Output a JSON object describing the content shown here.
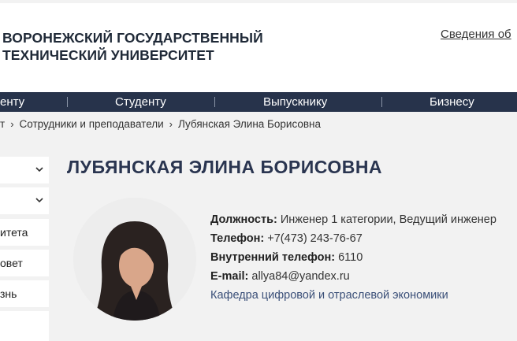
{
  "header": {
    "title_line1": "ВОРОНЕЖСКИЙ ГОСУДАРСТВЕННЫЙ",
    "title_line2": "ТЕХНИЧЕСКИЙ УНИВЕРСИТЕТ",
    "top_link": "Сведения об"
  },
  "nav": {
    "items": [
      {
        "label": "енту"
      },
      {
        "label": "Студенту"
      },
      {
        "label": "Выпускнику"
      },
      {
        "label": "Бизнесу"
      }
    ]
  },
  "breadcrumb": {
    "items": [
      {
        "label": "т"
      },
      {
        "label": "Сотрудники и преподаватели"
      },
      {
        "label": "Лубянская Элина Борисовна"
      }
    ]
  },
  "sidebar": {
    "items": [
      {
        "label": ""
      },
      {
        "label": ""
      },
      {
        "label": "итета"
      },
      {
        "label": "овет"
      },
      {
        "label": "знь"
      },
      {
        "label": ""
      }
    ]
  },
  "profile": {
    "name": "ЛУБЯНСКАЯ ЭЛИНА БОРИСОВНА",
    "position_label": "Должность:",
    "position_value": "Инженер 1 категории, Ведущий инженер",
    "phone_label": "Телефон:",
    "phone_value": "+7(473) 243-76-67",
    "internal_phone_label": "Внутренний телефон:",
    "internal_phone_value": "6110",
    "email_label": "E-mail:",
    "email_value": "allya84@yandex.ru",
    "department": "Кафедра цифровой и отраслевой экономики"
  },
  "colors": {
    "nav_bg": "#27334b",
    "name_color": "#2a3550",
    "link_color": "#3a4f78"
  }
}
